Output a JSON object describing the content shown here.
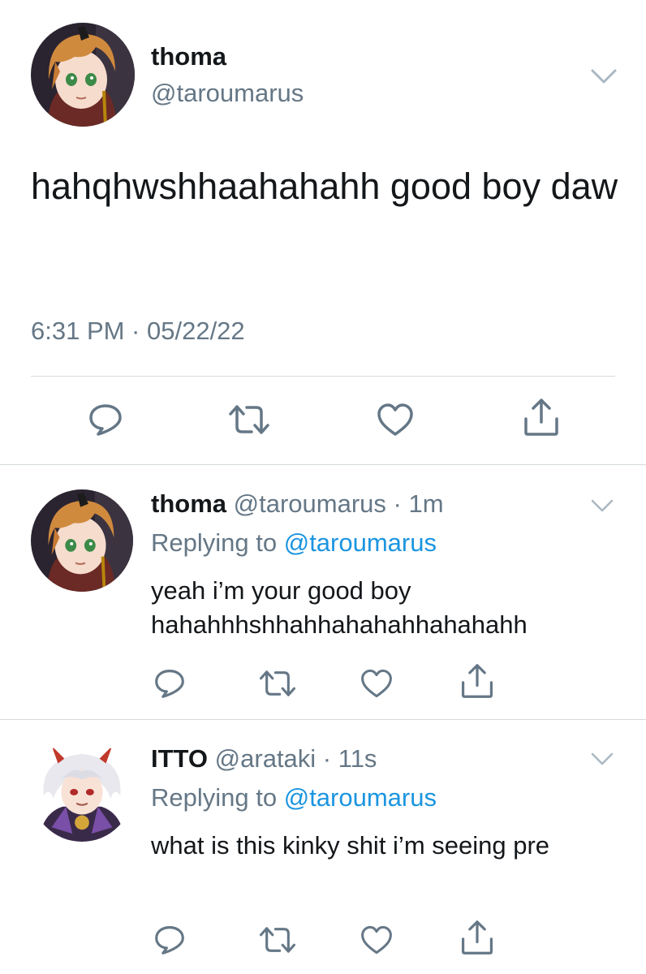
{
  "main_tweet": {
    "name": "thoma",
    "handle": "@taroumarus",
    "text": "hahqhwshhaahahahh good boy daw",
    "timestamp": "6:31 PM · 05/22/22",
    "avatar_icon": "avatar-thoma"
  },
  "replies": [
    {
      "name": "thoma",
      "handle": "@taroumarus",
      "time": "1m",
      "replying_prefix": "Replying to",
      "replying_to": "@taroumarus",
      "text": "yeah i’m your good boy hahahhhshhahhahahahhahahahh",
      "avatar_icon": "avatar-thoma"
    },
    {
      "name": "ITTO",
      "handle": "@arataki",
      "time": "11s",
      "replying_prefix": "Replying to",
      "replying_to": "@taroumarus",
      "text": "what is this kinky shit i’m seeing pre",
      "avatar_icon": "avatar-itto"
    }
  ],
  "separator": " · ",
  "icons": {
    "reply": "reply-icon",
    "retweet": "retweet-icon",
    "like": "like-icon",
    "share": "share-icon",
    "more": "chevron-down-icon"
  },
  "colors": {
    "text": "#14171a",
    "secondary": "#657786",
    "link": "#1b95e0",
    "divider": "#d6dade",
    "icon": "#657786"
  }
}
